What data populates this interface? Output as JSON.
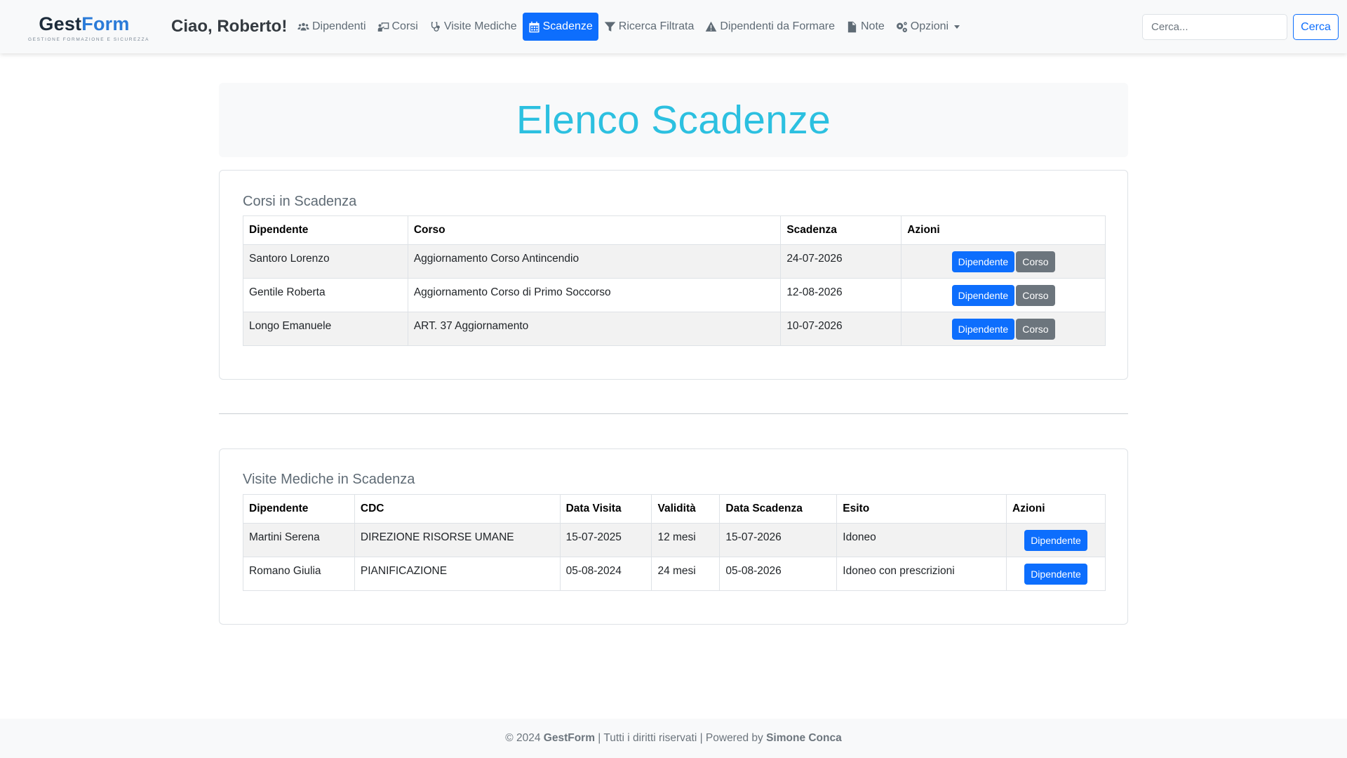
{
  "brand": {
    "name_part1": "Gest",
    "name_part2": "Form",
    "tagline": "GESTIONE FORMAZIONE E SICUREZZA"
  },
  "header": {
    "greeting": "Ciao, Roberto!"
  },
  "nav": {
    "dipendenti": "Dipendenti",
    "corsi": "Corsi",
    "visite": "Visite Mediche",
    "scadenze": "Scadenze",
    "ricerca": "Ricerca Filtrata",
    "da_formare": "Dipendenti da Formare",
    "note": "Note",
    "opzioni": "Opzioni"
  },
  "search": {
    "placeholder": "Cerca...",
    "button": "Cerca"
  },
  "page": {
    "title": "Elenco Scadenze"
  },
  "corsi": {
    "title": "Corsi in Scadenza",
    "headers": [
      "Dipendente",
      "Corso",
      "Scadenza",
      "Azioni"
    ],
    "rows": [
      {
        "dipendente": "Santoro Lorenzo",
        "corso": "Aggiornamento Corso Antincendio",
        "scadenza": "24-07-2026"
      },
      {
        "dipendente": "Gentile Roberta",
        "corso": "Aggiornamento Corso di Primo Soccorso",
        "scadenza": "12-08-2026"
      },
      {
        "dipendente": "Longo Emanuele",
        "corso": "ART. 37 Aggiornamento",
        "scadenza": "10-07-2026"
      }
    ],
    "btn_dipendente": "Dipendente",
    "btn_corso": "Corso"
  },
  "visite": {
    "title": "Visite Mediche in Scadenza",
    "headers": [
      "Dipendente",
      "CDC",
      "Data Visita",
      "Validità",
      "Data Scadenza",
      "Esito",
      "Azioni"
    ],
    "rows": [
      {
        "dipendente": "Martini Serena",
        "cdc": "DIREZIONE RISORSE UMANE",
        "data_visita": "15-07-2025",
        "validita": "12 mesi",
        "data_scadenza": "15-07-2026",
        "esito": "Idoneo"
      },
      {
        "dipendente": "Romano Giulia",
        "cdc": "PIANIFICAZIONE",
        "data_visita": "05-08-2024",
        "validita": "24 mesi",
        "data_scadenza": "05-08-2026",
        "esito": "Idoneo con prescrizioni"
      }
    ],
    "btn_dipendente": "Dipendente"
  },
  "footer": {
    "prefix": "© 2024 ",
    "brand": "GestForm",
    "middle": " | Tutti i diritti riservati | Powered by ",
    "author": "Simone Conca"
  },
  "colors": {
    "primary": "#0d6efd",
    "secondary": "#6c757d",
    "title": "#2cc0e0",
    "brand_dark": "#1c2b3a",
    "brand_blue": "#2b7bd8"
  },
  "icons": [
    "users-icon",
    "chalkboard-teacher-icon",
    "stethoscope-icon",
    "calendar-icon",
    "filter-icon",
    "warning-triangle-icon",
    "file-icon",
    "cogs-icon",
    "caret-down-icon"
  ]
}
